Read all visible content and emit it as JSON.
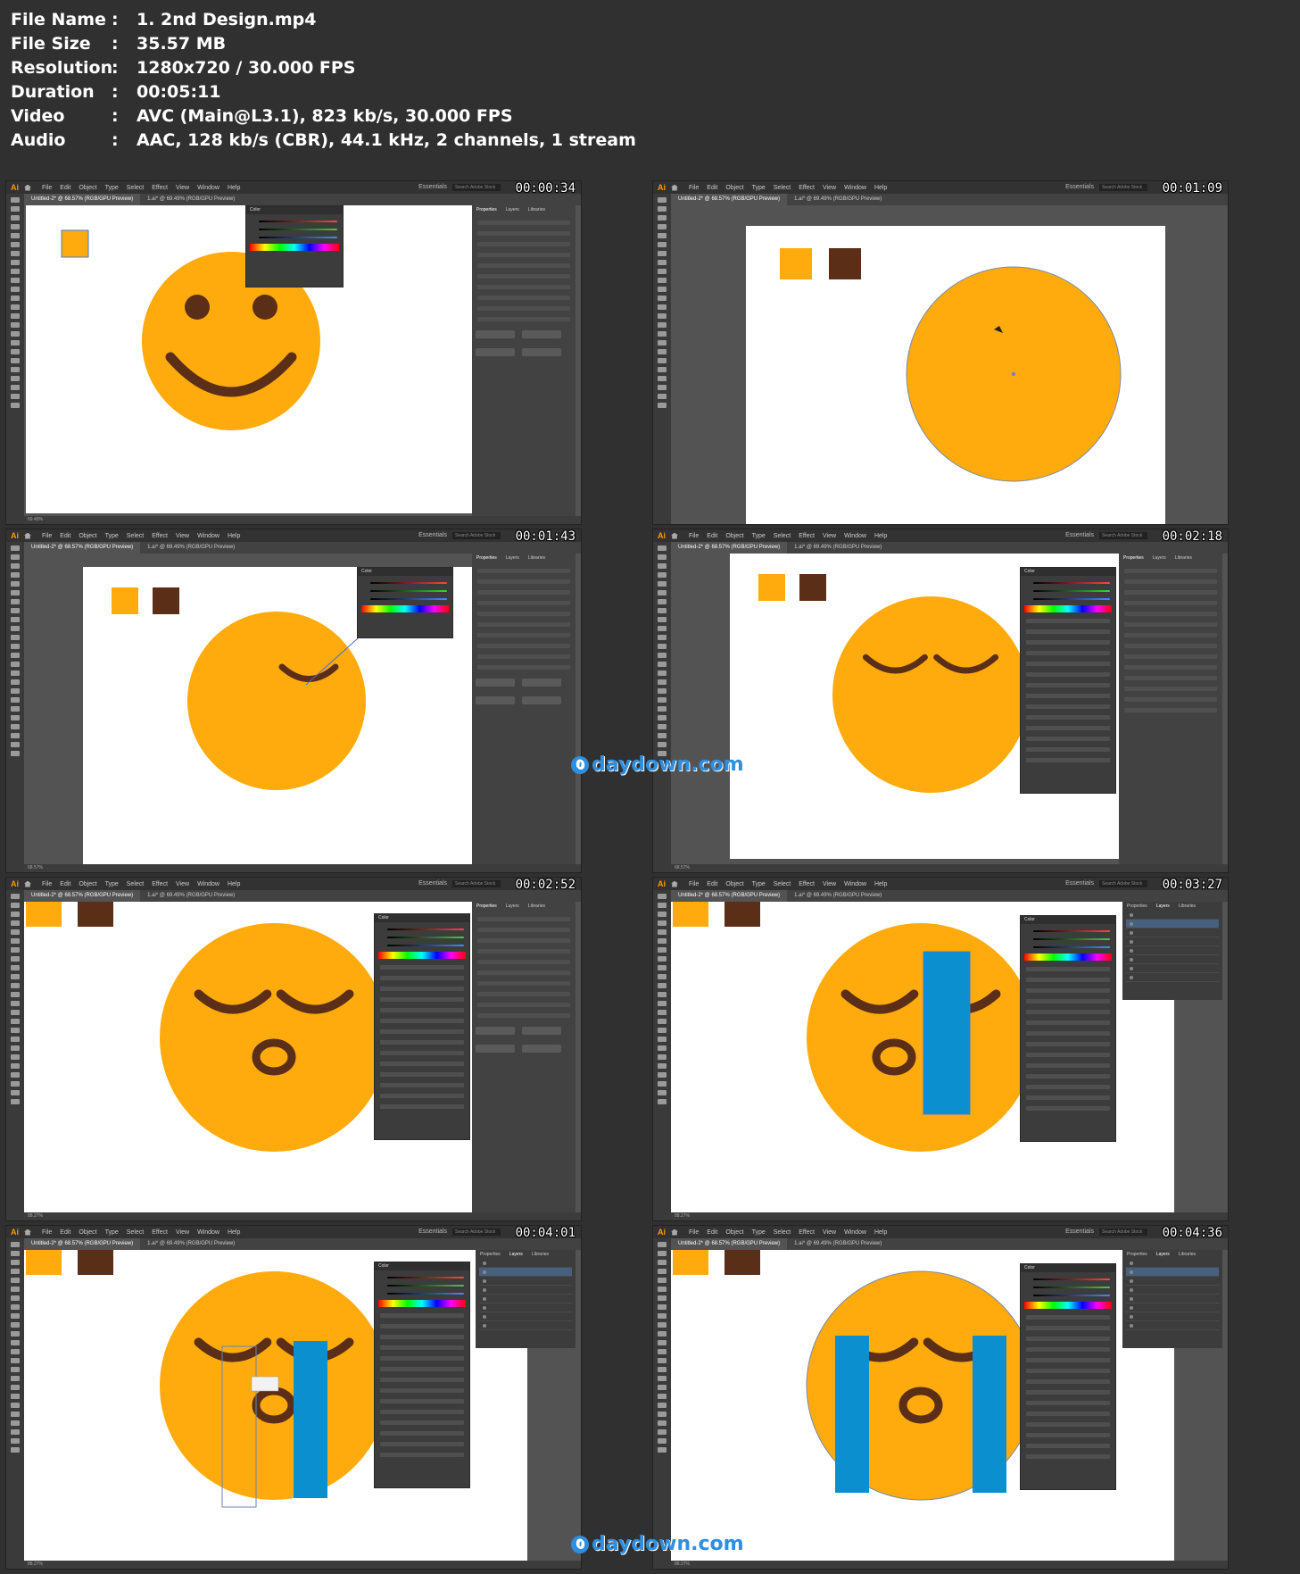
{
  "meta": {
    "labels": {
      "file_name": "File Name",
      "file_size": "File Size",
      "resolution": "Resolution",
      "duration": "Duration",
      "video": "Video",
      "audio": "Audio"
    },
    "colon": ":",
    "file_name": "1. 2nd Design.mp4",
    "file_size": "35.57 MB",
    "resolution": "1280x720 / 30.000 FPS",
    "duration": "00:05:11",
    "video": "AVC (Main@L3.1), 823 kb/s, 30.000 FPS",
    "audio": "AAC, 128 kb/s (CBR), 44.1 kHz, 2 channels, 1 stream"
  },
  "app": {
    "logo": "Ai",
    "menus": [
      "File",
      "Edit",
      "Object",
      "Type",
      "Select",
      "Effect",
      "View",
      "Window",
      "Help"
    ],
    "workspace": "Essentials",
    "search_placeholder": "Search Adobe Stock",
    "tabs": [
      "Untitled-2* @ 68.57% (RGB/GPU Preview)",
      "1.ai* @ 69.49% (RGB/GPU Preview)"
    ],
    "props_tabs": [
      "Properties",
      "Layers",
      "Libraries"
    ]
  },
  "colors": {
    "orange": "#FFAB0E",
    "brown": "#5B2E17",
    "blue": "#0C8FCF",
    "canvas": "#FFFFFF",
    "ui_dark": "#535353"
  },
  "frames": [
    {
      "timestamp": "00:00:34",
      "panel_title": "Color",
      "status": "69.49%"
    },
    {
      "timestamp": "00:01:09",
      "panel_title": "",
      "status": ""
    },
    {
      "timestamp": "00:01:43",
      "panel_title": "Color",
      "status": "68.57%"
    },
    {
      "timestamp": "00:02:18",
      "panel_title": "Color",
      "status": "68.57%"
    },
    {
      "timestamp": "00:02:52",
      "panel_title": "Color",
      "status": "88.27%"
    },
    {
      "timestamp": "00:03:27",
      "panel_title": "Color",
      "status": "88.27%"
    },
    {
      "timestamp": "00:04:01",
      "panel_title": "Color",
      "status": "88.27%"
    },
    {
      "timestamp": "00:04:36",
      "panel_title": "Color",
      "status": "88.27%"
    }
  ],
  "watermark": {
    "text": "daydown.com",
    "badge": "0"
  }
}
